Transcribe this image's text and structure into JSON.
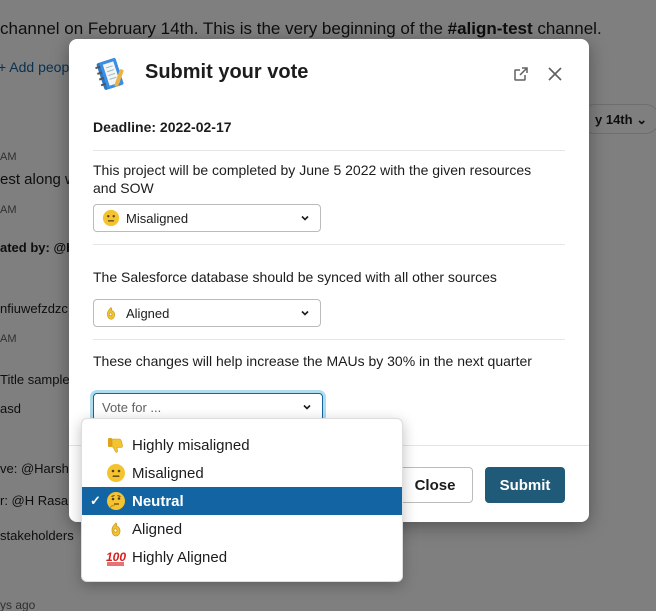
{
  "background": {
    "intro_prefix": "channel on February 14th. This is the very beginning of the ",
    "intro_channel": "#align-test",
    "intro_suffix": " channel.",
    "add_people": "+ Add peop",
    "date_pill": "y 14th",
    "fragments": [
      "AM",
      "est along w",
      "AM",
      "ated by: @H",
      "nfiuwefzdzc",
      "AM",
      "Title sample",
      "asd",
      "ve: @Harsh",
      "r: @H Rasan",
      "stakeholders",
      "ys ago"
    ]
  },
  "modal": {
    "title": "Submit your vote",
    "deadline": "Deadline: 2022-02-17",
    "questions": [
      {
        "text": "This project will be completed by June 5 2022 with the given resources and SOW",
        "selected": "Misaligned",
        "emoji": "neutral-face"
      },
      {
        "text": "The Salesforce database should be synced with all other sources",
        "selected": "Aligned",
        "emoji": "ok-hand"
      },
      {
        "text": "These changes will help increase the MAUs by 30% in the next quarter",
        "placeholder": "Vote for ..."
      }
    ],
    "close_label": "Close",
    "submit_label": "Submit"
  },
  "menu": {
    "options": [
      {
        "label": "Highly misaligned",
        "emoji": "thumbs-down"
      },
      {
        "label": "Misaligned",
        "emoji": "neutral-face"
      },
      {
        "label": "Neutral",
        "emoji": "thinking-face",
        "selected": true
      },
      {
        "label": "Aligned",
        "emoji": "ok-hand"
      },
      {
        "label": "Highly Aligned",
        "emoji": "hundred-points"
      }
    ]
  },
  "colors": {
    "accent": "#1264a3",
    "submit": "#1f5a78",
    "emoji_yellow": "#f4c430"
  }
}
